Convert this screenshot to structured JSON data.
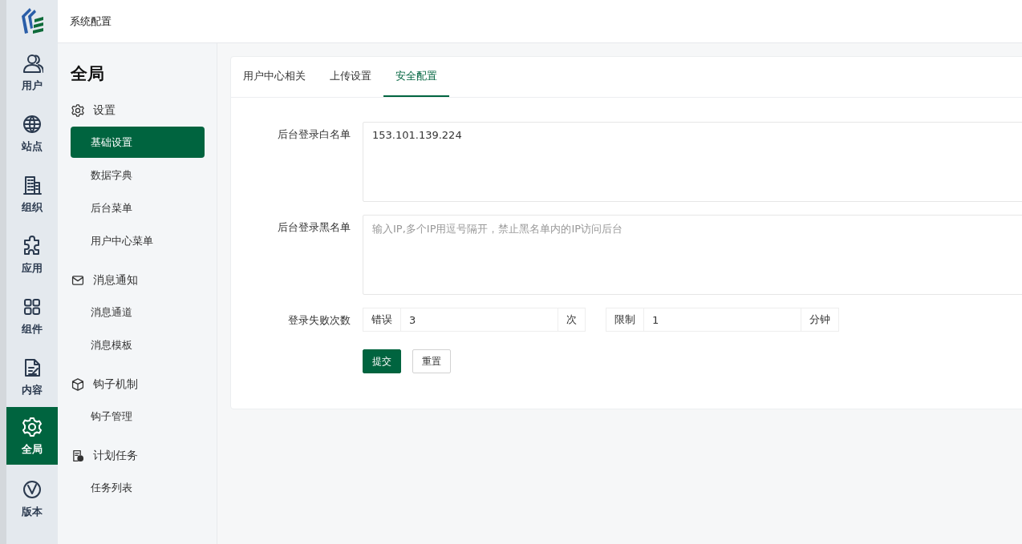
{
  "header": {
    "title": "系统配置"
  },
  "rail": [
    {
      "label": "用户",
      "kind": "users",
      "selected": false
    },
    {
      "label": "站点",
      "kind": "globe",
      "selected": false
    },
    {
      "label": "组织",
      "kind": "building",
      "selected": false
    },
    {
      "label": "应用",
      "kind": "puzzle",
      "selected": false
    },
    {
      "label": "组件",
      "kind": "grid",
      "selected": false
    },
    {
      "label": "内容",
      "kind": "document",
      "selected": false
    },
    {
      "label": "全局",
      "kind": "gear",
      "selected": true
    },
    {
      "label": "版本",
      "kind": "vcircle",
      "selected": false
    }
  ],
  "sidebar": {
    "title": "全局",
    "groups": [
      {
        "label": "设置",
        "kind": "gear",
        "items": [
          {
            "label": "基础设置",
            "selected": true
          },
          {
            "label": "数据字典",
            "selected": false
          },
          {
            "label": "后台菜单",
            "selected": false
          },
          {
            "label": "用户中心菜单",
            "selected": false
          }
        ]
      },
      {
        "label": "消息通知",
        "kind": "mail",
        "items": [
          {
            "label": "消息通道",
            "selected": false
          },
          {
            "label": "消息模板",
            "selected": false
          }
        ]
      },
      {
        "label": "钩子机制",
        "kind": "cube",
        "items": [
          {
            "label": "钩子管理",
            "selected": false
          }
        ]
      },
      {
        "label": "计划任务",
        "kind": "task",
        "items": [
          {
            "label": "任务列表",
            "selected": false
          }
        ]
      }
    ]
  },
  "tabs": [
    {
      "label": "用户中心相关",
      "selected": false
    },
    {
      "label": "上传设置",
      "selected": false
    },
    {
      "label": "安全配置",
      "selected": true
    }
  ],
  "form": {
    "whitelist": {
      "label": "后台登录白名单",
      "value": "153.101.139.224"
    },
    "blacklist": {
      "label": "后台登录黑名单",
      "placeholder": "输入IP,多个IP用逗号隔开，禁止黑名单内的IP访问后台"
    },
    "login_failures": {
      "label": "登录失败次数",
      "groups": [
        {
          "prefix": "错误",
          "value": "3",
          "suffix": "次"
        },
        {
          "prefix": "限制",
          "value": "1",
          "suffix": "分钟"
        }
      ]
    }
  },
  "buttons": [
    {
      "label": "提交",
      "kind": "primary"
    },
    {
      "label": "重置",
      "kind": "default"
    }
  ]
}
